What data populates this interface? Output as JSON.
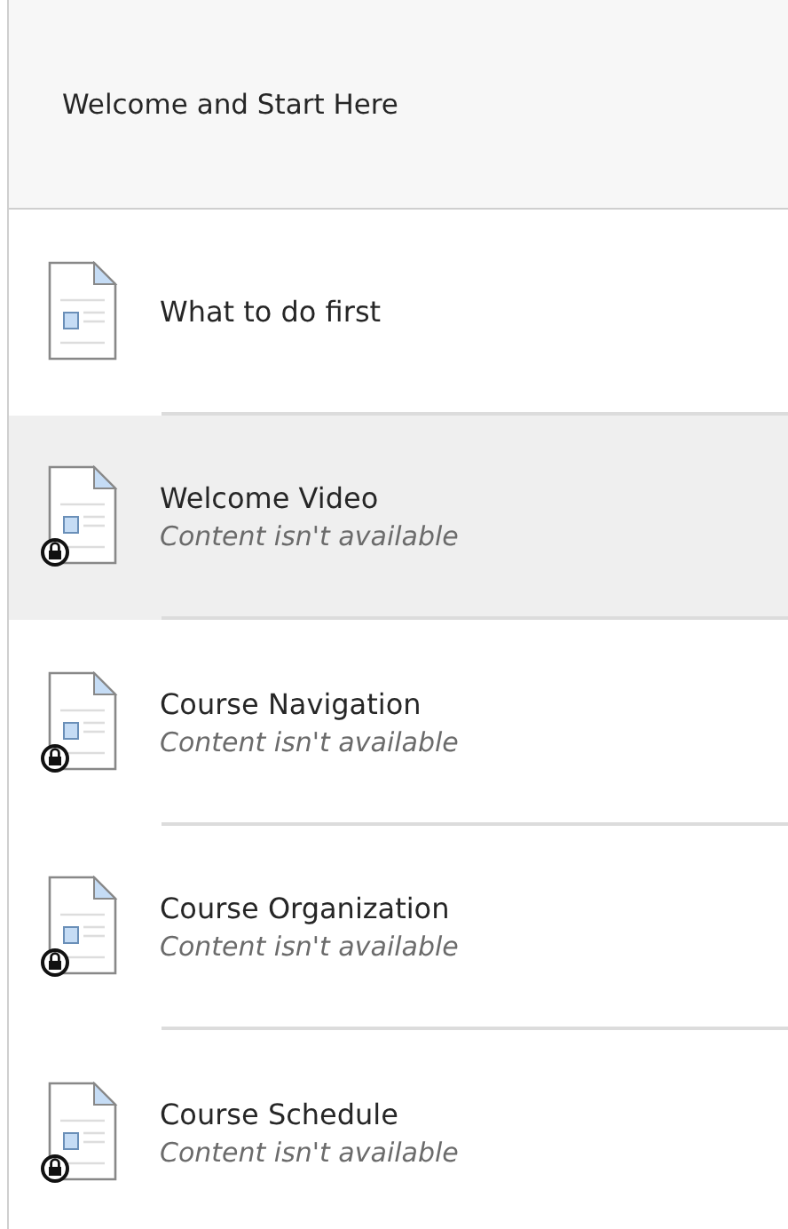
{
  "header": {
    "title": "Welcome and Start Here"
  },
  "items": [
    {
      "title": "What to do first",
      "locked": false,
      "selected": false
    },
    {
      "title": "Welcome Video",
      "note": "Content isn't available",
      "locked": true,
      "selected": true
    },
    {
      "title": "Course Navigation",
      "note": "Content isn't available",
      "locked": true,
      "selected": false
    },
    {
      "title": "Course Organization",
      "note": "Content isn't available",
      "locked": true,
      "selected": false
    },
    {
      "title": "Course Schedule",
      "note": "Content isn't available",
      "locked": true,
      "selected": false
    }
  ]
}
